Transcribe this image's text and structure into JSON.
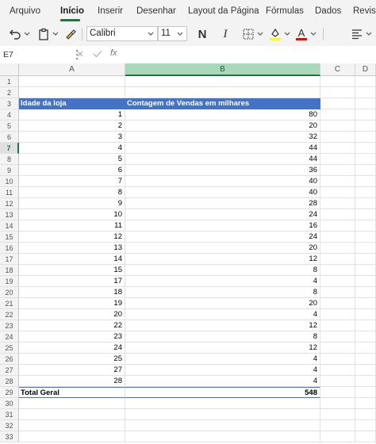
{
  "ribbon": {
    "tabs": [
      {
        "label": "Arquivo",
        "active": false
      },
      {
        "label": "Início",
        "active": true
      },
      {
        "label": "Inserir",
        "active": false
      },
      {
        "label": "Desenhar",
        "active": false
      },
      {
        "label": "Layout da Página",
        "active": false
      },
      {
        "label": "Fórmulas",
        "active": false
      },
      {
        "label": "Dados",
        "active": false
      },
      {
        "label": "Revisã",
        "active": false
      }
    ],
    "accent_color": "#217346"
  },
  "toolbar": {
    "font_name": "Calibri",
    "font_size": "11",
    "bold_label": "N",
    "italic_label": "I",
    "underline_label": "A",
    "icons": [
      "undo-icon",
      "paste-icon",
      "format-painter-icon",
      "borders-icon",
      "fill-color-icon",
      "font-color-icon",
      "align-icon"
    ],
    "fill_color": "#ffff00",
    "font_color": "#ff0000"
  },
  "formula_bar": {
    "name_box": "E7",
    "fx_label": "fx",
    "formula": ""
  },
  "grid": {
    "columns": [
      "A",
      "B",
      "C",
      "D"
    ],
    "selected_column": "B",
    "selected_row": "7",
    "header_color": "#4472c4",
    "pivot_header": {
      "col_a": "Idade da loja",
      "col_b": "Contagem de Vendas em milhares"
    },
    "pivot_rows": [
      {
        "age": "1",
        "count": "80"
      },
      {
        "age": "2",
        "count": "20"
      },
      {
        "age": "3",
        "count": "32"
      },
      {
        "age": "4",
        "count": "44"
      },
      {
        "age": "5",
        "count": "44"
      },
      {
        "age": "6",
        "count": "36"
      },
      {
        "age": "7",
        "count": "40"
      },
      {
        "age": "8",
        "count": "40"
      },
      {
        "age": "9",
        "count": "28"
      },
      {
        "age": "10",
        "count": "24"
      },
      {
        "age": "11",
        "count": "16"
      },
      {
        "age": "12",
        "count": "24"
      },
      {
        "age": "13",
        "count": "20"
      },
      {
        "age": "14",
        "count": "12"
      },
      {
        "age": "15",
        "count": "8"
      },
      {
        "age": "17",
        "count": "4"
      },
      {
        "age": "18",
        "count": "8"
      },
      {
        "age": "19",
        "count": "20"
      },
      {
        "age": "20",
        "count": "4"
      },
      {
        "age": "22",
        "count": "12"
      },
      {
        "age": "23",
        "count": "8"
      },
      {
        "age": "24",
        "count": "12"
      },
      {
        "age": "25",
        "count": "4"
      },
      {
        "age": "27",
        "count": "4"
      },
      {
        "age": "28",
        "count": "4"
      }
    ],
    "total": {
      "label": "Total Geral",
      "value": "548"
    },
    "row_numbers": [
      "1",
      "2",
      "3",
      "4",
      "5",
      "6",
      "7",
      "8",
      "9",
      "10",
      "11",
      "12",
      "13",
      "14",
      "15",
      "16",
      "17",
      "18",
      "19",
      "20",
      "21",
      "22",
      "23",
      "24",
      "25",
      "26",
      "27",
      "28",
      "29",
      "30",
      "31",
      "32",
      "33"
    ]
  }
}
